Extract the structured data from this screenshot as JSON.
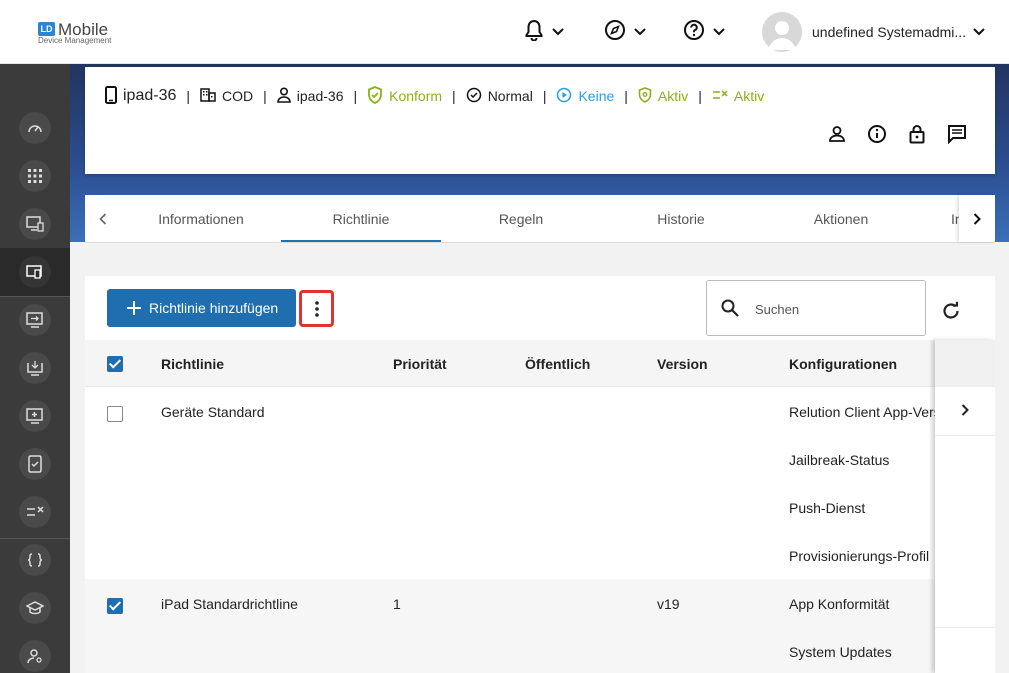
{
  "app": {
    "logo_badge": "LD",
    "logo_title": "Mobile",
    "logo_subtitle": "Device Management",
    "user_name": "undefined Systemadmi..."
  },
  "device": {
    "name": "ipad-36",
    "org": "COD",
    "user": "ipad-36",
    "compliance": "Konform",
    "status": "Normal",
    "mode": "Keine",
    "shield_state": "Aktiv",
    "rule_state": "Aktiv"
  },
  "tabs": [
    {
      "label": "Informationen"
    },
    {
      "label": "Richtlinie"
    },
    {
      "label": "Regeln"
    },
    {
      "label": "Historie"
    },
    {
      "label": "Aktionen"
    },
    {
      "label": "In"
    }
  ],
  "toolbar": {
    "add_label": "Richtlinie hinzufügen",
    "search_placeholder": "Suchen"
  },
  "table": {
    "columns": [
      "Richtlinie",
      "Priorität",
      "Öffentlich",
      "Version",
      "Konfigurationen"
    ],
    "rows": [
      {
        "name": "Geräte Standard",
        "priority": "",
        "public": "",
        "version": "",
        "configs": [
          "Relution Client App-Version",
          "Jailbreak-Status",
          "Push-Dienst",
          "Provisionierungs-Profil"
        ]
      },
      {
        "name": "iPad Standardrichtline",
        "priority": "1",
        "public": "",
        "version": "v19",
        "configs": [
          "App Konformität",
          "System Updates"
        ]
      }
    ]
  },
  "colors": {
    "primary": "#1f6fb0",
    "green": "#8ab11a",
    "blue": "#2a9de0",
    "sidebar": "#3b3b3b",
    "highlight": "#e03333"
  }
}
